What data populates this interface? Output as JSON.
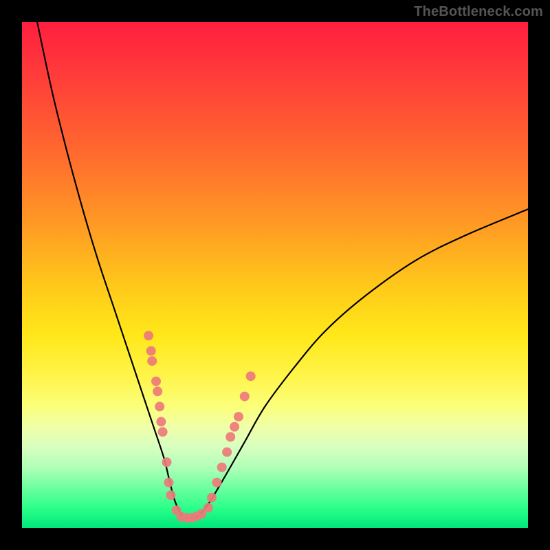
{
  "watermark": "TheBottleneck.com",
  "colors": {
    "frame": "#000000",
    "curve": "#000000",
    "marker": "#ee7a79",
    "gradient_top": "#ff1f3f",
    "gradient_bottom": "#00e87a"
  },
  "chart_data": {
    "type": "line",
    "title": "",
    "xlabel": "",
    "ylabel": "",
    "xlim": [
      0,
      100
    ],
    "ylim": [
      0,
      100
    ],
    "grid": false,
    "legend": false,
    "series": [
      {
        "name": "bottleneck-curve",
        "x": [
          3,
          6,
          9,
          12,
          15,
          18,
          20,
          22,
          24,
          26,
          28,
          29,
          30,
          31,
          32,
          33,
          34,
          35,
          37,
          40,
          44,
          48,
          54,
          60,
          68,
          78,
          88,
          100
        ],
        "y": [
          100,
          86,
          74,
          63,
          53,
          44,
          38,
          32,
          26,
          20,
          14,
          10,
          6,
          3.5,
          2,
          2,
          2,
          2.5,
          5,
          10,
          17,
          24,
          32,
          39,
          46,
          53,
          58,
          63
        ]
      }
    ],
    "markers": [
      {
        "x": 25,
        "y": 38
      },
      {
        "x": 25.5,
        "y": 35
      },
      {
        "x": 25.7,
        "y": 33
      },
      {
        "x": 26.5,
        "y": 29
      },
      {
        "x": 26.8,
        "y": 27
      },
      {
        "x": 27.2,
        "y": 24
      },
      {
        "x": 27.5,
        "y": 21
      },
      {
        "x": 27.8,
        "y": 19
      },
      {
        "x": 28.6,
        "y": 13
      },
      {
        "x": 29,
        "y": 9
      },
      {
        "x": 29.4,
        "y": 6.5
      },
      {
        "x": 30.5,
        "y": 3.5
      },
      {
        "x": 31.5,
        "y": 2.2
      },
      {
        "x": 32.5,
        "y": 2
      },
      {
        "x": 33.5,
        "y": 2
      },
      {
        "x": 34.5,
        "y": 2.3
      },
      {
        "x": 35.5,
        "y": 2.8
      },
      {
        "x": 36.8,
        "y": 4
      },
      {
        "x": 37.5,
        "y": 6
      },
      {
        "x": 38.5,
        "y": 9
      },
      {
        "x": 39.5,
        "y": 12
      },
      {
        "x": 40.5,
        "y": 15
      },
      {
        "x": 41.2,
        "y": 18
      },
      {
        "x": 42,
        "y": 20
      },
      {
        "x": 42.8,
        "y": 22
      },
      {
        "x": 44,
        "y": 26
      },
      {
        "x": 45.2,
        "y": 30
      }
    ]
  }
}
